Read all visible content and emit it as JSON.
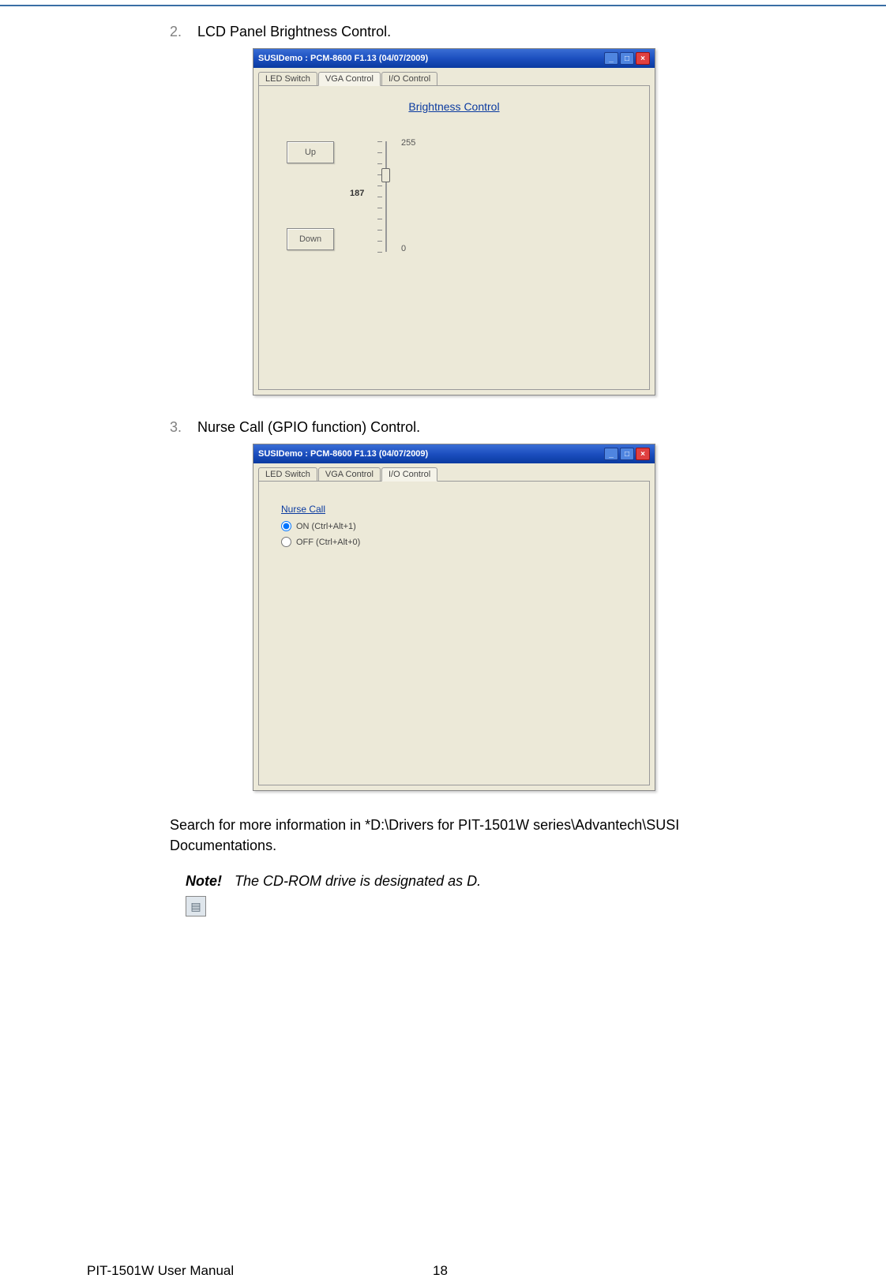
{
  "list": {
    "item2": {
      "num": "2.",
      "text": "LCD Panel Brightness Control."
    },
    "item3": {
      "num": "3.",
      "text": "Nurse Call (GPIO function) Control."
    }
  },
  "window1": {
    "title": "SUSIDemo : PCM-8600 F1.13 (04/07/2009)",
    "tabs": {
      "t1": "LED Switch",
      "t2": "VGA Control",
      "t3": "I/O Control"
    },
    "heading": "Brightness Control",
    "btn_up": "Up",
    "btn_down": "Down",
    "max": "255",
    "current": "187",
    "min": "0"
  },
  "window2": {
    "title": "SUSIDemo : PCM-8600 F1.13 (04/07/2009)",
    "tabs": {
      "t1": "LED Switch",
      "t2": "VGA Control",
      "t3": "I/O Control"
    },
    "group": "Nurse Call",
    "opt_on": "ON  (Ctrl+Alt+1)",
    "opt_off": "OFF (Ctrl+Alt+0)"
  },
  "paragraph": "Search for more information in *D:\\Drivers for PIT-1501W series\\Advantech\\SUSI Documentations.",
  "note": {
    "label": "Note!",
    "text": "The CD-ROM drive is designated as D."
  },
  "footer": {
    "manual": "PIT-1501W User Manual",
    "page": "18"
  },
  "icons": {
    "minimize": "_",
    "maximize": "□",
    "close": "×",
    "notepad": "▤"
  }
}
